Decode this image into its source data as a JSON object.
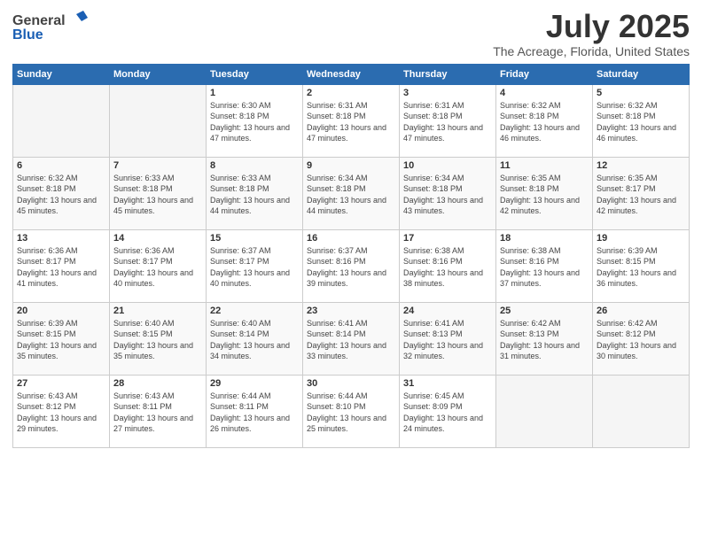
{
  "header": {
    "logo_general": "General",
    "logo_blue": "Blue",
    "month_year": "July 2025",
    "location": "The Acreage, Florida, United States"
  },
  "weekdays": [
    "Sunday",
    "Monday",
    "Tuesday",
    "Wednesday",
    "Thursday",
    "Friday",
    "Saturday"
  ],
  "weeks": [
    [
      {
        "day": "",
        "sunrise": "",
        "sunset": "",
        "daylight": "",
        "empty": true
      },
      {
        "day": "",
        "sunrise": "",
        "sunset": "",
        "daylight": "",
        "empty": true
      },
      {
        "day": "1",
        "sunrise": "Sunrise: 6:30 AM",
        "sunset": "Sunset: 8:18 PM",
        "daylight": "Daylight: 13 hours and 47 minutes."
      },
      {
        "day": "2",
        "sunrise": "Sunrise: 6:31 AM",
        "sunset": "Sunset: 8:18 PM",
        "daylight": "Daylight: 13 hours and 47 minutes."
      },
      {
        "day": "3",
        "sunrise": "Sunrise: 6:31 AM",
        "sunset": "Sunset: 8:18 PM",
        "daylight": "Daylight: 13 hours and 47 minutes."
      },
      {
        "day": "4",
        "sunrise": "Sunrise: 6:32 AM",
        "sunset": "Sunset: 8:18 PM",
        "daylight": "Daylight: 13 hours and 46 minutes."
      },
      {
        "day": "5",
        "sunrise": "Sunrise: 6:32 AM",
        "sunset": "Sunset: 8:18 PM",
        "daylight": "Daylight: 13 hours and 46 minutes."
      }
    ],
    [
      {
        "day": "6",
        "sunrise": "Sunrise: 6:32 AM",
        "sunset": "Sunset: 8:18 PM",
        "daylight": "Daylight: 13 hours and 45 minutes."
      },
      {
        "day": "7",
        "sunrise": "Sunrise: 6:33 AM",
        "sunset": "Sunset: 8:18 PM",
        "daylight": "Daylight: 13 hours and 45 minutes."
      },
      {
        "day": "8",
        "sunrise": "Sunrise: 6:33 AM",
        "sunset": "Sunset: 8:18 PM",
        "daylight": "Daylight: 13 hours and 44 minutes."
      },
      {
        "day": "9",
        "sunrise": "Sunrise: 6:34 AM",
        "sunset": "Sunset: 8:18 PM",
        "daylight": "Daylight: 13 hours and 44 minutes."
      },
      {
        "day": "10",
        "sunrise": "Sunrise: 6:34 AM",
        "sunset": "Sunset: 8:18 PM",
        "daylight": "Daylight: 13 hours and 43 minutes."
      },
      {
        "day": "11",
        "sunrise": "Sunrise: 6:35 AM",
        "sunset": "Sunset: 8:18 PM",
        "daylight": "Daylight: 13 hours and 42 minutes."
      },
      {
        "day": "12",
        "sunrise": "Sunrise: 6:35 AM",
        "sunset": "Sunset: 8:17 PM",
        "daylight": "Daylight: 13 hours and 42 minutes."
      }
    ],
    [
      {
        "day": "13",
        "sunrise": "Sunrise: 6:36 AM",
        "sunset": "Sunset: 8:17 PM",
        "daylight": "Daylight: 13 hours and 41 minutes."
      },
      {
        "day": "14",
        "sunrise": "Sunrise: 6:36 AM",
        "sunset": "Sunset: 8:17 PM",
        "daylight": "Daylight: 13 hours and 40 minutes."
      },
      {
        "day": "15",
        "sunrise": "Sunrise: 6:37 AM",
        "sunset": "Sunset: 8:17 PM",
        "daylight": "Daylight: 13 hours and 40 minutes."
      },
      {
        "day": "16",
        "sunrise": "Sunrise: 6:37 AM",
        "sunset": "Sunset: 8:16 PM",
        "daylight": "Daylight: 13 hours and 39 minutes."
      },
      {
        "day": "17",
        "sunrise": "Sunrise: 6:38 AM",
        "sunset": "Sunset: 8:16 PM",
        "daylight": "Daylight: 13 hours and 38 minutes."
      },
      {
        "day": "18",
        "sunrise": "Sunrise: 6:38 AM",
        "sunset": "Sunset: 8:16 PM",
        "daylight": "Daylight: 13 hours and 37 minutes."
      },
      {
        "day": "19",
        "sunrise": "Sunrise: 6:39 AM",
        "sunset": "Sunset: 8:15 PM",
        "daylight": "Daylight: 13 hours and 36 minutes."
      }
    ],
    [
      {
        "day": "20",
        "sunrise": "Sunrise: 6:39 AM",
        "sunset": "Sunset: 8:15 PM",
        "daylight": "Daylight: 13 hours and 35 minutes."
      },
      {
        "day": "21",
        "sunrise": "Sunrise: 6:40 AM",
        "sunset": "Sunset: 8:15 PM",
        "daylight": "Daylight: 13 hours and 35 minutes."
      },
      {
        "day": "22",
        "sunrise": "Sunrise: 6:40 AM",
        "sunset": "Sunset: 8:14 PM",
        "daylight": "Daylight: 13 hours and 34 minutes."
      },
      {
        "day": "23",
        "sunrise": "Sunrise: 6:41 AM",
        "sunset": "Sunset: 8:14 PM",
        "daylight": "Daylight: 13 hours and 33 minutes."
      },
      {
        "day": "24",
        "sunrise": "Sunrise: 6:41 AM",
        "sunset": "Sunset: 8:13 PM",
        "daylight": "Daylight: 13 hours and 32 minutes."
      },
      {
        "day": "25",
        "sunrise": "Sunrise: 6:42 AM",
        "sunset": "Sunset: 8:13 PM",
        "daylight": "Daylight: 13 hours and 31 minutes."
      },
      {
        "day": "26",
        "sunrise": "Sunrise: 6:42 AM",
        "sunset": "Sunset: 8:12 PM",
        "daylight": "Daylight: 13 hours and 30 minutes."
      }
    ],
    [
      {
        "day": "27",
        "sunrise": "Sunrise: 6:43 AM",
        "sunset": "Sunset: 8:12 PM",
        "daylight": "Daylight: 13 hours and 29 minutes."
      },
      {
        "day": "28",
        "sunrise": "Sunrise: 6:43 AM",
        "sunset": "Sunset: 8:11 PM",
        "daylight": "Daylight: 13 hours and 27 minutes."
      },
      {
        "day": "29",
        "sunrise": "Sunrise: 6:44 AM",
        "sunset": "Sunset: 8:11 PM",
        "daylight": "Daylight: 13 hours and 26 minutes."
      },
      {
        "day": "30",
        "sunrise": "Sunrise: 6:44 AM",
        "sunset": "Sunset: 8:10 PM",
        "daylight": "Daylight: 13 hours and 25 minutes."
      },
      {
        "day": "31",
        "sunrise": "Sunrise: 6:45 AM",
        "sunset": "Sunset: 8:09 PM",
        "daylight": "Daylight: 13 hours and 24 minutes."
      },
      {
        "day": "",
        "sunrise": "",
        "sunset": "",
        "daylight": "",
        "empty": true
      },
      {
        "day": "",
        "sunrise": "",
        "sunset": "",
        "daylight": "",
        "empty": true
      }
    ]
  ]
}
